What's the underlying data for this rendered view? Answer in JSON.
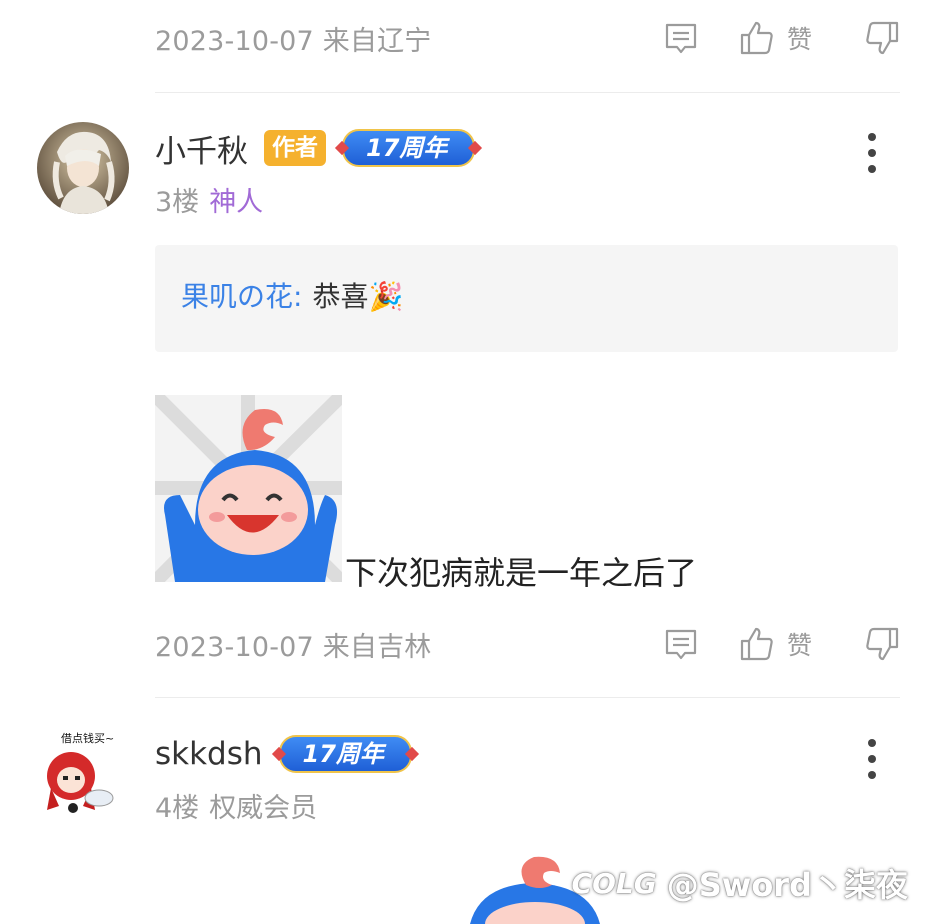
{
  "comments": [
    {
      "date_location": "2023-10-07 来自辽宁",
      "like_label": "赞"
    },
    {
      "username": "小千秋",
      "author_badge": "作者",
      "anniversary_badge": "17周年",
      "floor": "3楼",
      "title": "神人",
      "quote": {
        "name": "果叽の花:",
        "text": "恭喜🎉"
      },
      "text": "下次犯病就是一年之后了",
      "date_location": "2023-10-07 来自吉林",
      "like_label": "赞"
    },
    {
      "username": "skkdsh",
      "anniversary_badge": "17周年",
      "floor": "4楼",
      "title": "权威会员",
      "avatar_caption": "借点钱买~"
    }
  ],
  "watermark": {
    "logo": "COLG",
    "text": "@Sword丶柒夜"
  },
  "colors": {
    "meta_gray": "#9b9b9b",
    "author_badge": "#f5b12e",
    "quote_name": "#3b82e6",
    "title_purple": "#a16ad6"
  },
  "icons": [
    "reply-icon",
    "thumbs-up-icon",
    "thumbs-down-icon",
    "more-icon"
  ]
}
